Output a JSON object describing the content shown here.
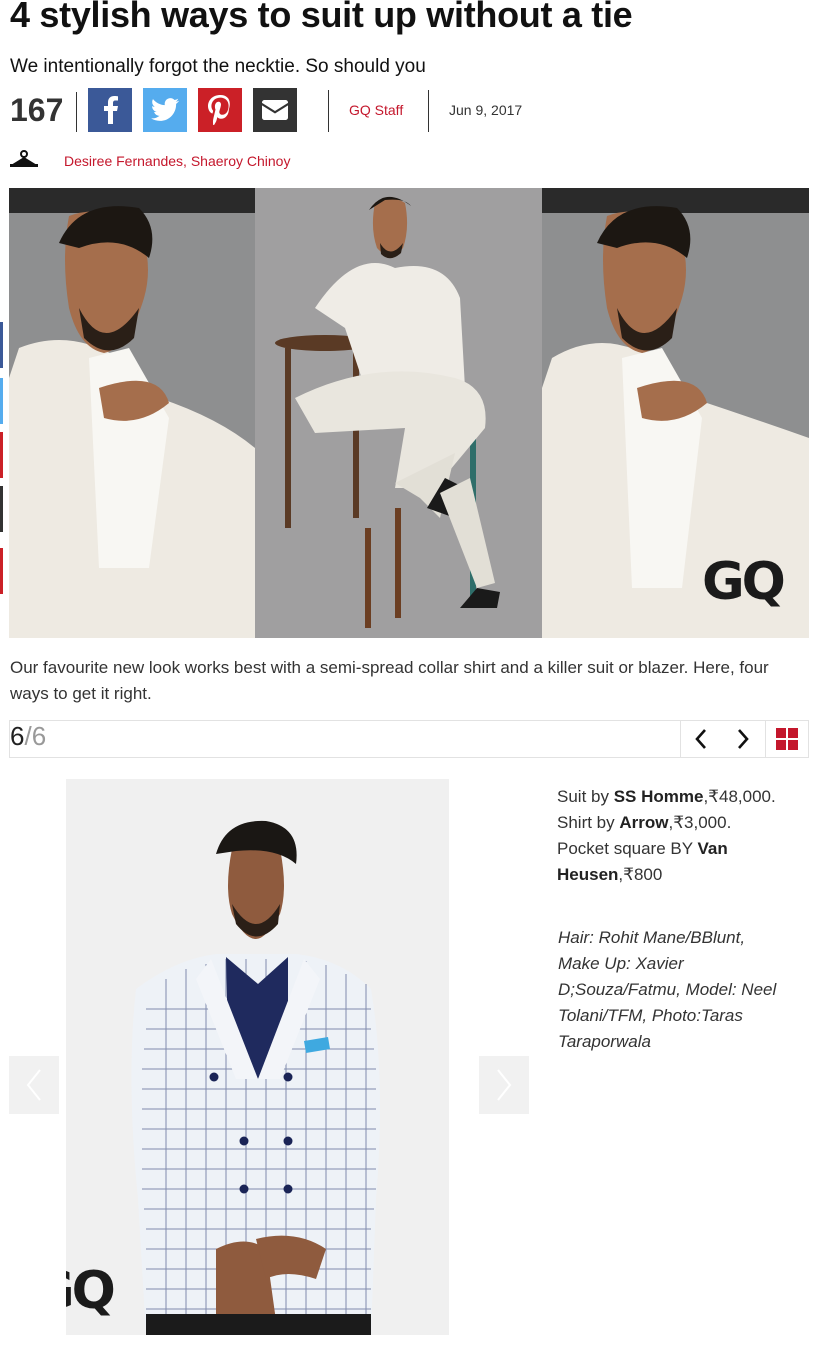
{
  "article": {
    "title": "4 stylish ways to suit up without a tie",
    "subtitle": "We intentionally forgot the necktie. So should you",
    "share_count": "167",
    "author": "GQ Staff",
    "date": "Jun 9, 2017",
    "credits": "Desiree Fernandes, Shaeroy Chinoy",
    "lead": "Our favourite new look works best with a semi-spread collar shirt and a killer suit or blazer. Here, four ways to get it right.",
    "hero_logo": "GQ"
  },
  "share": {
    "buttons": [
      {
        "name": "facebook",
        "icon": "facebook-icon",
        "color": "#3b5998"
      },
      {
        "name": "twitter",
        "icon": "twitter-icon",
        "color": "#55acee"
      },
      {
        "name": "pinterest",
        "icon": "pinterest-icon",
        "color": "#cb2027"
      },
      {
        "name": "email",
        "icon": "email-icon",
        "color": "#333333"
      }
    ]
  },
  "gallery": {
    "current": "6",
    "separator": "/",
    "total": "6",
    "prev_icon": "chevron-left-icon",
    "next_icon": "chevron-right-icon",
    "grid_icon": "grid-icon",
    "grid_color": "#c4172c",
    "slide_logo": "GQ",
    "description": {
      "p1": "Suit by ",
      "b1": "SS Homme",
      "p2": ",₹48,000. Shirt by ",
      "b2": "Arrow",
      "p3": ",₹3,000. Pocket square BY ",
      "b3": "Van Heusen",
      "p4": ",₹800"
    },
    "photo_credits": "Hair: Rohit Mane/BBlunt, Make Up: Xavier D;Souza/Fatmu, Model: Neel Tolani/TFM, Photo:Taras Taraporwala"
  },
  "colors": {
    "accent": "#c4172c",
    "text": "#333333"
  }
}
